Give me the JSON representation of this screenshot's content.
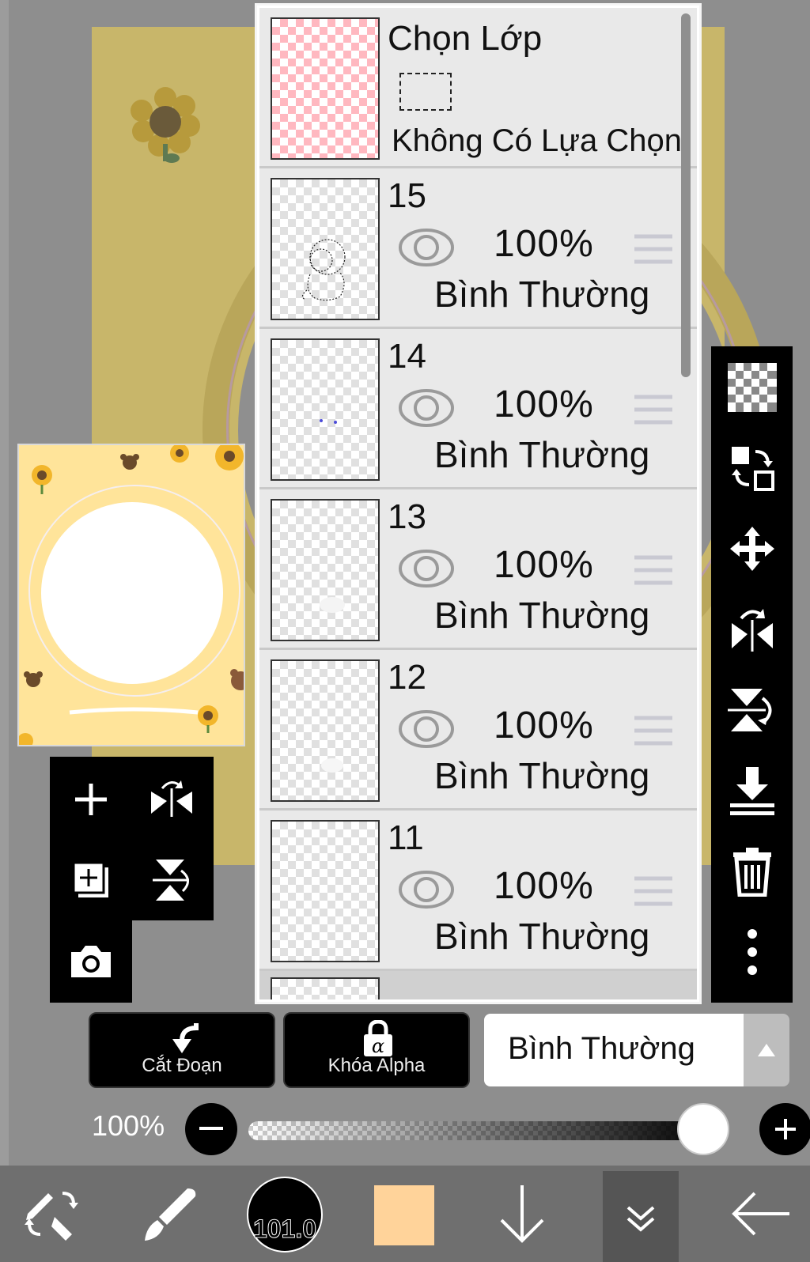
{
  "layer_panel": {
    "selection_layer": {
      "title": "Chọn Lớp",
      "subtitle": "Không Có Lựa Chọn"
    },
    "layers": [
      {
        "number": "15",
        "opacity": "100%",
        "blend_mode": "Bình Thường"
      },
      {
        "number": "14",
        "opacity": "100%",
        "blend_mode": "Bình Thường"
      },
      {
        "number": "13",
        "opacity": "100%",
        "blend_mode": "Bình Thường"
      },
      {
        "number": "12",
        "opacity": "100%",
        "blend_mode": "Bình Thường"
      },
      {
        "number": "11",
        "opacity": "100%",
        "blend_mode": "Bình Thường"
      }
    ]
  },
  "layer_options": {
    "clipping_label": "Cắt Đoạn",
    "alpha_lock_label": "Khóa Alpha",
    "blend_mode_value": "Bình Thường"
  },
  "opacity_control": {
    "label": "100%",
    "value_fraction": 1.0
  },
  "bottom_toolbar": {
    "brush_size": "101.0",
    "current_color": "#ffd39a"
  },
  "colors": {
    "accent_pink": "#ffb8c0",
    "navigator_bg": "#ffe49a"
  }
}
